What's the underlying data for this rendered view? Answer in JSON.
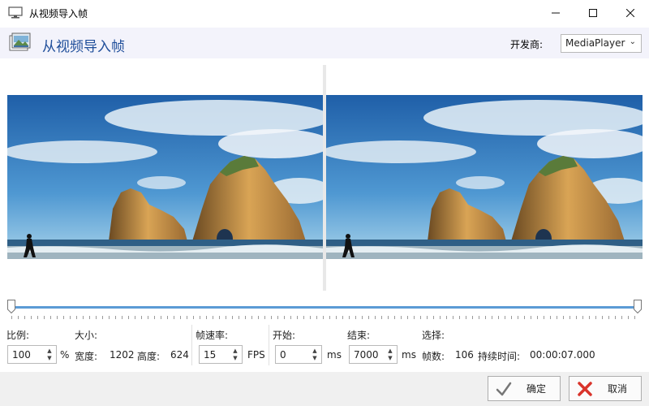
{
  "window": {
    "title": "从视频导入帧",
    "minimize_icon": "minimize-icon",
    "maximize_icon": "maximize-icon",
    "close_icon": "close-icon"
  },
  "header": {
    "title": "从视频导入帧",
    "vendor_label": "开发商:",
    "vendor_value": "MediaPlayer"
  },
  "slider": {
    "start_fraction": 0.0,
    "end_fraction": 1.0
  },
  "controls": {
    "ratio_label": "比例:",
    "ratio_value": "100",
    "ratio_unit": "%",
    "size_label": "大小:",
    "width_label": "宽度:",
    "width_value": "1202",
    "height_label": "高度:",
    "height_value": "624",
    "fps_label": "帧速率:",
    "fps_value": "15",
    "fps_unit": "FPS",
    "start_label": "开始:",
    "start_value": "0",
    "start_unit": "ms",
    "end_label": "结束:",
    "end_value": "7000",
    "end_unit": "ms",
    "selection_label": "选择:",
    "frames_label": "帧数:",
    "frames_value": "106",
    "duration_label": "持续时间:",
    "duration_value": "00:00:07.000"
  },
  "buttons": {
    "ok_label": "确定",
    "cancel_label": "取消"
  },
  "colors": {
    "accent": "#5b9bd5",
    "header_title": "#1f4e9a",
    "ok_check": "#777777",
    "cancel_x": "#d9342b"
  }
}
